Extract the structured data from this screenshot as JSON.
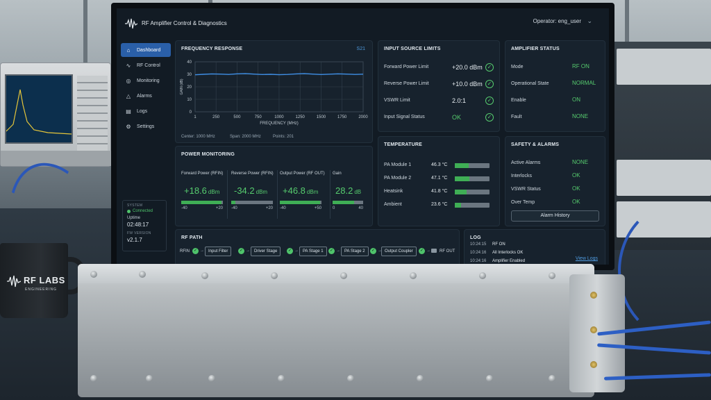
{
  "app": {
    "title": "RF Amplifier Control & Diagnostics",
    "operator": "Operator: eng_user"
  },
  "sidebar": {
    "items": [
      {
        "label": "Dashboard",
        "icon": "home-icon",
        "active": true
      },
      {
        "label": "RF Control",
        "icon": "rf-control-icon"
      },
      {
        "label": "Monitoring",
        "icon": "monitoring-icon"
      },
      {
        "label": "Alarms",
        "icon": "alarm-icon"
      },
      {
        "label": "Logs",
        "icon": "logs-icon"
      },
      {
        "label": "Settings",
        "icon": "settings-icon"
      }
    ],
    "system": {
      "label": "SYSTEM",
      "status": "Connected",
      "uptime_label": "Uptime",
      "uptime": "02:48:17",
      "fw_label": "FW VERSION",
      "fw": "v2.1.7"
    }
  },
  "freq_panel": {
    "title": "FREQUENCY RESPONSE",
    "badge": "S21",
    "center": "Center: 1000 MHz",
    "span": "Span: 2000 MHz",
    "points": "Points: 201"
  },
  "chart_data": {
    "type": "line",
    "ylabel": "GAIN (dB)",
    "xlabel": "FREQUENCY (MHz)",
    "xlim": [
      1,
      2000
    ],
    "ylim": [
      0,
      40
    ],
    "xticks": [
      1,
      250,
      500,
      750,
      1000,
      1250,
      1500,
      1750,
      2000
    ],
    "yticks": [
      0,
      10,
      20,
      30,
      40
    ],
    "grid": true,
    "series": [
      {
        "color": "#3f8fe6",
        "x": [
          1,
          100,
          200,
          300,
          400,
          500,
          600,
          700,
          800,
          900,
          1000,
          1100,
          1200,
          1300,
          1400,
          1500,
          1600,
          1700,
          1800,
          1900,
          2000
        ],
        "y": [
          29.6,
          30.0,
          30.3,
          30.2,
          29.9,
          30.4,
          30.6,
          30.2,
          29.8,
          30.0,
          29.7,
          29.9,
          30.3,
          30.6,
          30.2,
          29.8,
          30.1,
          30.4,
          30.2,
          29.9,
          30.1
        ]
      }
    ]
  },
  "limits": {
    "title": "INPUT SOURCE LIMITS",
    "rows": [
      {
        "label": "Forward Power Limit",
        "value": "+20.0 dBm"
      },
      {
        "label": "Reverse Power Limit",
        "value": "+10.0 dBm"
      },
      {
        "label": "VSWR Limit",
        "value": "2.0:1"
      },
      {
        "label": "Input Signal Status",
        "value": "OK"
      }
    ]
  },
  "amp": {
    "title": "AMPLIFIER STATUS",
    "rows": [
      {
        "label": "Mode",
        "value": "RF ON"
      },
      {
        "label": "Operational State",
        "value": "NORMAL"
      },
      {
        "label": "Enable",
        "value": "ON"
      },
      {
        "label": "Fault",
        "value": "NONE"
      }
    ]
  },
  "power": {
    "title": "POWER MONITORING",
    "cols": [
      {
        "label": "Forward Power (RFIN)",
        "value": "+18.6",
        "unit": "dBm",
        "min": "-40",
        "max": "+20",
        "fill": 0.97
      },
      {
        "label": "Reverse Power (RFIN)",
        "value": "-34.2",
        "unit": "dBm",
        "min": "-40",
        "max": "+20",
        "fill": 0.1
      },
      {
        "label": "Output Power (RF OUT)",
        "value": "+46.8",
        "unit": "dBm",
        "min": "-40",
        "max": "+50",
        "fill": 0.96
      },
      {
        "label": "Gain",
        "value": "28.2",
        "unit": "dB",
        "min": "0",
        "max": "40",
        "fill": 0.7
      }
    ]
  },
  "temperature": {
    "title": "TEMPERATURE",
    "rows": [
      {
        "label": "PA Module 1",
        "value": "46.3 °C",
        "fill": 0.4
      },
      {
        "label": "PA Module 2",
        "value": "47.1 °C",
        "fill": 0.42
      },
      {
        "label": "Heatsink",
        "value": "41.8 °C",
        "fill": 0.34
      },
      {
        "label": "Ambient",
        "value": "23.6 °C",
        "fill": 0.18
      }
    ]
  },
  "safety": {
    "title": "SAFETY & ALARMS",
    "rows": [
      {
        "label": "Active Alarms",
        "value": "NONE"
      },
      {
        "label": "Interlocks",
        "value": "OK"
      },
      {
        "label": "VSWR Status",
        "value": "OK"
      },
      {
        "label": "Over Temp",
        "value": "OK"
      }
    ],
    "button": "Alarm History"
  },
  "rf_path": {
    "title": "RF PATH",
    "start": "RFIN",
    "stages": [
      "Input Filter",
      "Driver Stage",
      "PA Stage 1",
      "PA Stage 2",
      "Output Coupler"
    ],
    "end": "RF OUT"
  },
  "log": {
    "title": "LOG",
    "entries": [
      {
        "time": "10:24:15",
        "msg": "RF ON"
      },
      {
        "time": "10:24:16",
        "msg": "All Interlocks OK"
      },
      {
        "time": "10:24:16",
        "msg": "Amplifier Enabled"
      }
    ],
    "link": "View Logs"
  },
  "mug": {
    "brand": "RF LABS",
    "sub": "ENGINEERING"
  },
  "colors": {
    "accent": "#2a5fa8",
    "ok": "#56cc6e",
    "panel": "#17222d"
  }
}
